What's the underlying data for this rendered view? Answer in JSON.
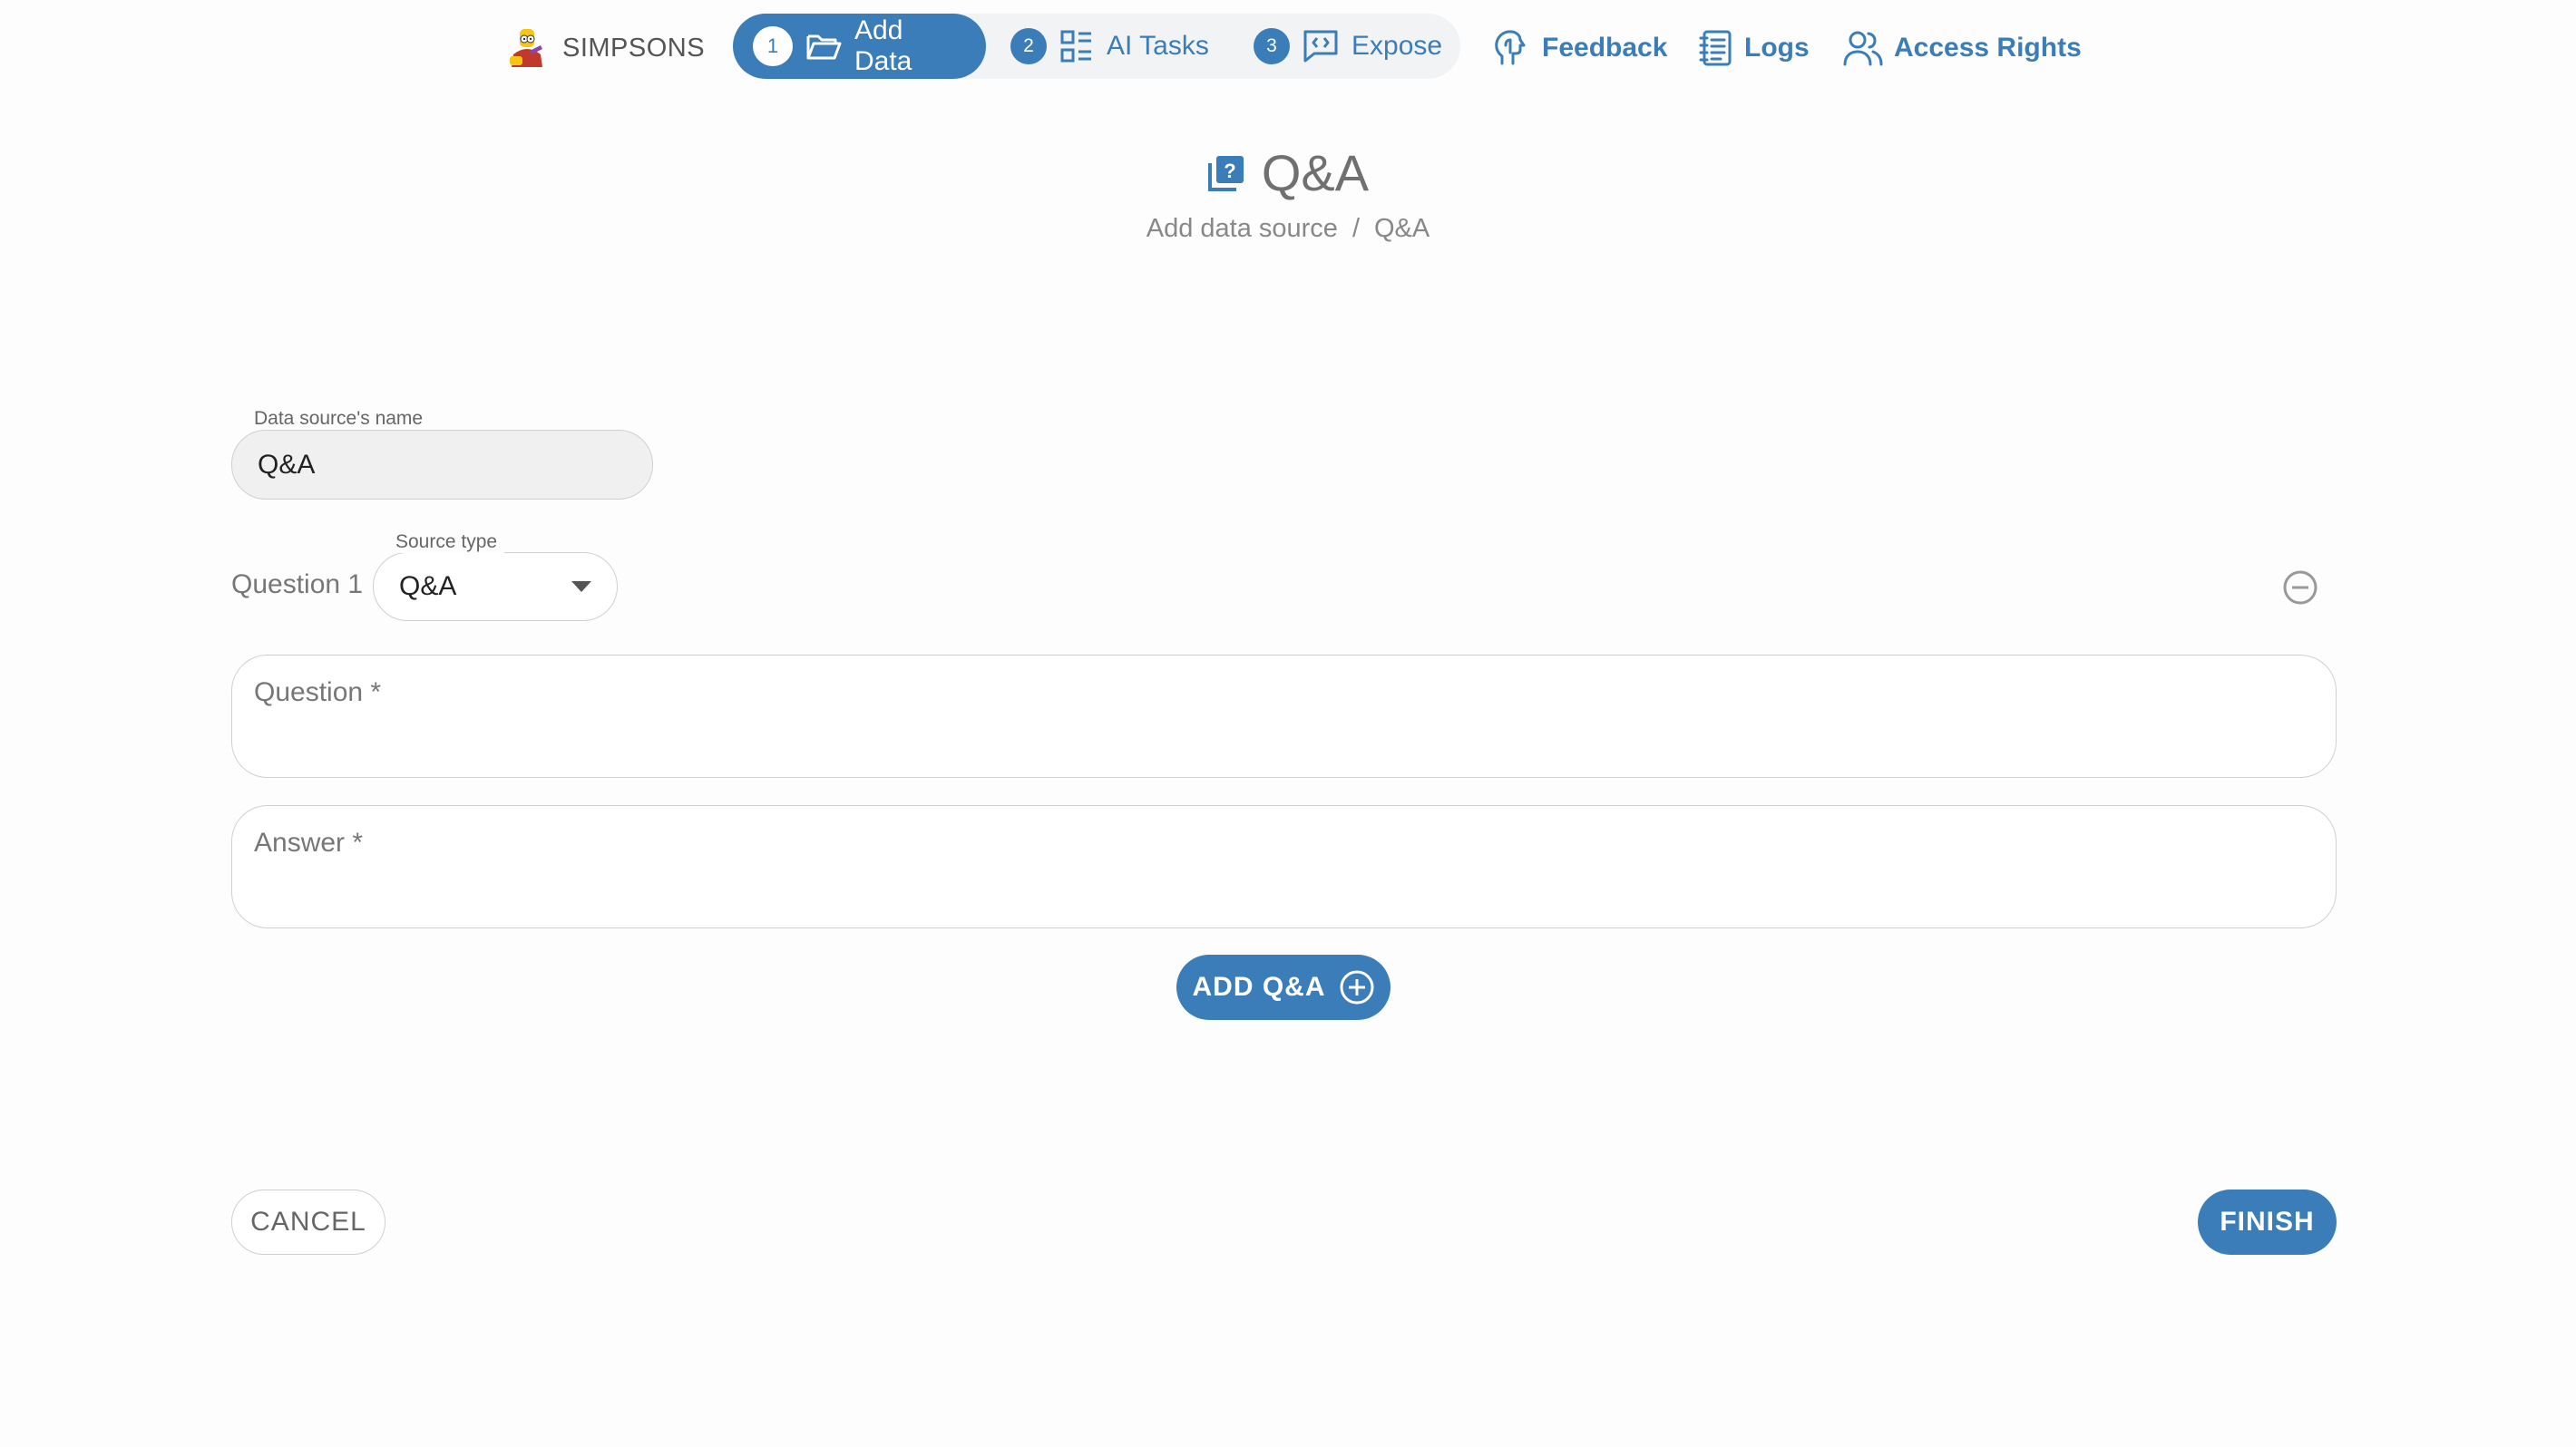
{
  "brand": {
    "name": "SIMPSONS",
    "icon": "simpson-avatar-icon"
  },
  "steps": [
    {
      "num": "1",
      "label": "Add Data",
      "icon": "folder-open-icon",
      "active": true
    },
    {
      "num": "2",
      "label": "AI Tasks",
      "icon": "grid-list-icon",
      "active": false
    },
    {
      "num": "3",
      "label": "Expose",
      "icon": "code-chat-icon",
      "active": false
    }
  ],
  "toplinks": [
    {
      "label": "Feedback",
      "icon": "feedback-head-icon"
    },
    {
      "label": "Logs",
      "icon": "logs-notebook-icon"
    },
    {
      "label": "Access Rights",
      "icon": "users-icon"
    }
  ],
  "page": {
    "title": "Q&A",
    "title_icon": "question-library-icon",
    "breadcrumb": [
      "Add data source",
      "/",
      "Q&A"
    ]
  },
  "form": {
    "name_label": "Data source's name",
    "name_value": "Q&A",
    "question_number": "Question 1",
    "source_type_label": "Source type",
    "source_type_value": "Q&A",
    "question_placeholder": "Question *",
    "answer_placeholder": "Answer *",
    "add_button": "ADD Q&A",
    "cancel_button": "CANCEL",
    "finish_button": "FINISH"
  },
  "colors": {
    "accent": "#3a7db8",
    "step_bar_bg": "#f1f3f5",
    "text_muted": "#777777"
  }
}
